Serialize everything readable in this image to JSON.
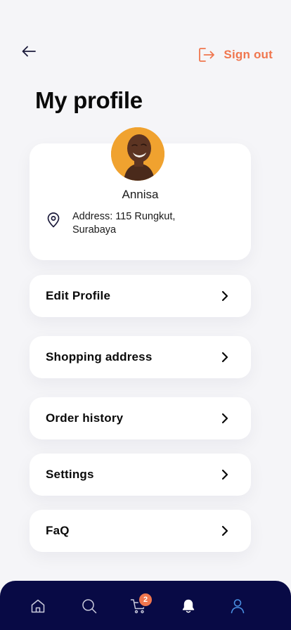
{
  "header": {
    "back_icon": "arrow-left-icon",
    "signout_icon": "logout-icon",
    "signout_label": "Sign out",
    "title": "My profile"
  },
  "profile": {
    "avatar_icon": "avatar-photo",
    "name": "Annisa",
    "address_icon": "map-pin-icon",
    "address": "Address: 115 Rungkut, Surabaya"
  },
  "menu": [
    {
      "label": "Edit Profile",
      "icon": "chevron-right-icon"
    },
    {
      "label": "Shopping address",
      "icon": "chevron-right-icon"
    },
    {
      "label": "Order history",
      "icon": "chevron-right-icon"
    },
    {
      "label": "Settings",
      "icon": "chevron-right-icon"
    },
    {
      "label": "FaQ",
      "icon": "chevron-right-icon"
    }
  ],
  "bottom_nav": {
    "items": [
      "home-icon",
      "search-icon",
      "cart-icon",
      "bell-icon",
      "user-icon"
    ],
    "active": "user-icon",
    "cart_badge": "2"
  },
  "colors": {
    "accent": "#f0764e",
    "nav_bg": "#080a45",
    "active_nav": "#4a90e2",
    "background": "#f5f5f8"
  }
}
